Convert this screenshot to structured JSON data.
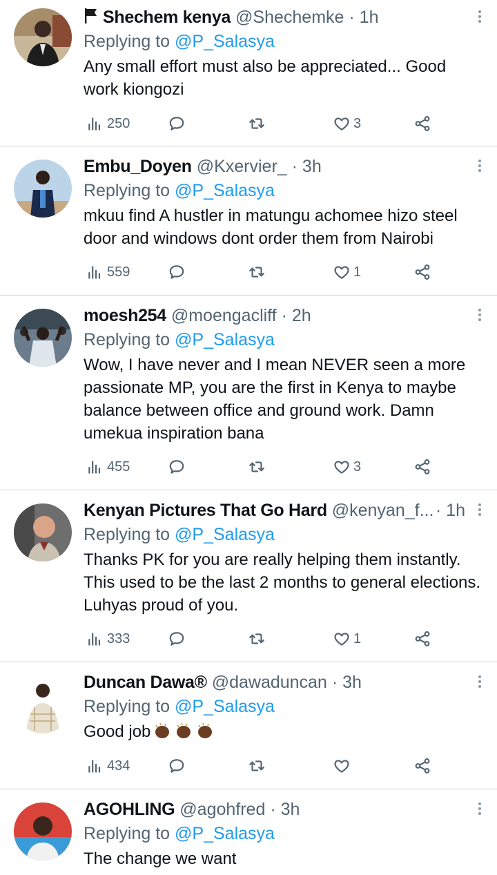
{
  "tweets": [
    {
      "name": "Shechem kenya",
      "flag": true,
      "handle": "@Shechemke",
      "time": "· 1h",
      "reply_prefix": "Replying to ",
      "mention": "@P_Salasya",
      "text": "Any small effort must also be appreciated... Good work kiongozi",
      "views": "250",
      "likes": "3"
    },
    {
      "name": "Embu_Doyen",
      "handle": "@Kxervier_",
      "time": "· 3h",
      "reply_prefix": "Replying to ",
      "mention": "@P_Salasya",
      "text": "mkuu find A hustler in matungu achomee hizo steel door and windows dont order them from Nairobi",
      "views": "559",
      "likes": "1"
    },
    {
      "name": "moesh254",
      "handle": "@moengacliff",
      "time": "· 2h",
      "reply_prefix": "Replying to ",
      "mention": "@P_Salasya",
      "text": "Wow,  I have never and I mean NEVER seen a more passionate MP, you are the first in Kenya to maybe balance between office and ground work. Damn umekua inspiration bana",
      "views": "455",
      "likes": "3"
    },
    {
      "name": "Kenyan Pictures That Go Hard",
      "handle": "@kenyan_f...",
      "time": "· 1h",
      "reply_prefix": "Replying to ",
      "mention": "@P_Salasya",
      "text": "Thanks PK for you are really helping them instantly. This used to be the last 2 months to general elections. Luhyas proud of you.",
      "views": "333",
      "likes": "1"
    },
    {
      "name": "Duncan Dawa®",
      "handle": "@dawaduncan",
      "time": "· 3h",
      "reply_prefix": "Replying to ",
      "mention": "@P_Salasya",
      "text": "Good job",
      "emoji": "clapping-hands-x3",
      "views": "434",
      "likes": ""
    },
    {
      "name": "AGOHLING",
      "handle": "@agohfred",
      "time": "· 3h",
      "reply_prefix": "Replying to ",
      "mention": "@P_Salasya",
      "text": "The change we want"
    }
  ],
  "colors": {
    "accent": "#1d9bf0",
    "secondary": "#536471",
    "divider": "#cfd9de"
  }
}
